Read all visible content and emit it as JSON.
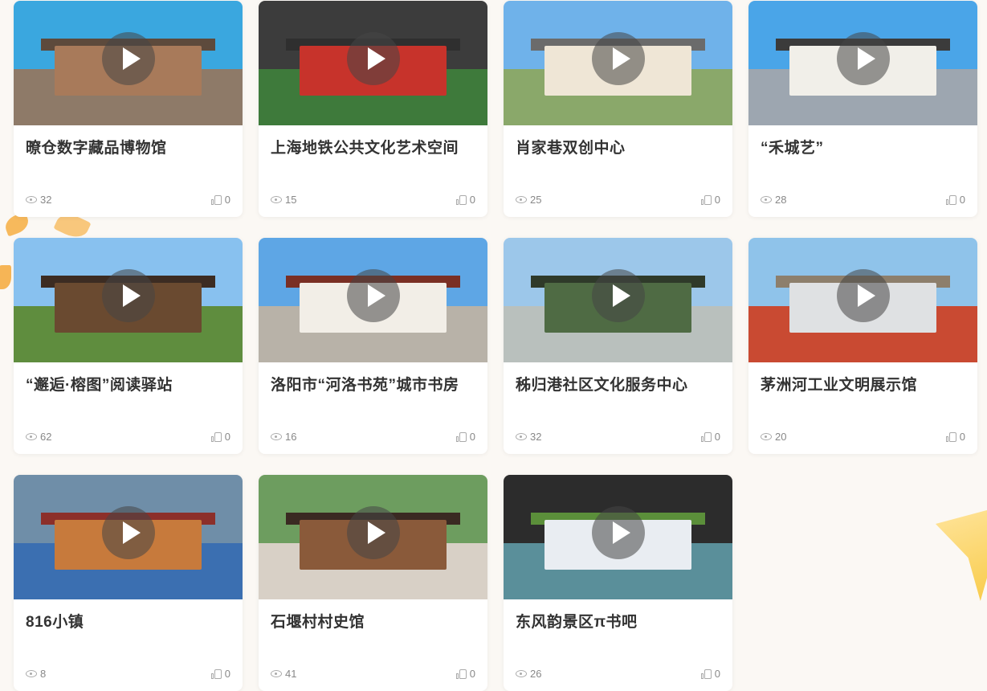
{
  "cards": [
    {
      "title": "暸仓数字藏品博物馆",
      "views": "32",
      "likes": "0",
      "colors": {
        "sky": "#3aa7df",
        "ground": "#8e7a68",
        "bld": "#a87a5a",
        "roof": "#5d4a3c"
      }
    },
    {
      "title": "上海地铁公共文化艺术空间",
      "views": "15",
      "likes": "0",
      "colors": {
        "sky": "#3c3c3c",
        "ground": "#3e7a3b",
        "bld": "#c7332b",
        "roof": "#2f2f2f"
      }
    },
    {
      "title": "肖家巷双创中心",
      "views": "25",
      "likes": "0",
      "colors": {
        "sky": "#6fb2ea",
        "ground": "#8aa86a",
        "bld": "#efe6d6",
        "roof": "#6b6b6b"
      }
    },
    {
      "title": "“禾城艺”",
      "views": "28",
      "likes": "0",
      "colors": {
        "sky": "#4aa5e8",
        "ground": "#9da6b0",
        "bld": "#f1efe9",
        "roof": "#3b3b3b"
      }
    },
    {
      "title": "“邂逅·榕图”阅读驿站",
      "views": "62",
      "likes": "0",
      "colors": {
        "sky": "#88c1ef",
        "ground": "#5f8d3e",
        "bld": "#6a4a30",
        "roof": "#3c2c22"
      }
    },
    {
      "title": "洛阳市“河洛书苑”城市书房",
      "views": "16",
      "likes": "0",
      "colors": {
        "sky": "#5ea6e5",
        "ground": "#b8b2a8",
        "bld": "#f2eee7",
        "roof": "#7a2f24"
      }
    },
    {
      "title": "秭归港社区文化服务中心",
      "views": "32",
      "likes": "0",
      "colors": {
        "sky": "#9cc7ea",
        "ground": "#b9c0bd",
        "bld": "#4f6b44",
        "roof": "#2f3a2a"
      }
    },
    {
      "title": "茅洲河工业文明展示馆",
      "views": "20",
      "likes": "0",
      "colors": {
        "sky": "#8fc3ea",
        "ground": "#c94a32",
        "bld": "#dfe1e3",
        "roof": "#8d7f6c"
      }
    },
    {
      "title": "816小镇",
      "views": "8",
      "likes": "0",
      "colors": {
        "sky": "#6f8ea8",
        "ground": "#3b6fb1",
        "bld": "#c77a3c",
        "roof": "#8c2f2a"
      }
    },
    {
      "title": "石堰村村史馆",
      "views": "41",
      "likes": "0",
      "colors": {
        "sky": "#6d9d5f",
        "ground": "#d8d0c6",
        "bld": "#8a5a3a",
        "roof": "#3a2a22"
      }
    },
    {
      "title": "东风韵景区π书吧",
      "views": "26",
      "likes": "0",
      "colors": {
        "sky": "#2c2c2c",
        "ground": "#5a8f9a",
        "bld": "#e9edf2",
        "roof": "#5b8f3a"
      }
    }
  ]
}
